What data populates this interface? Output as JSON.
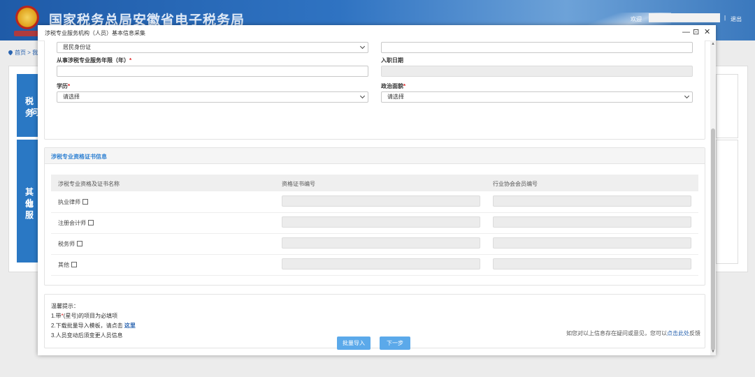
{
  "portal": {
    "site_title": "国家税务总局安徽省电子税务局",
    "welcome": "欢迎",
    "separator": "|",
    "logout": "退出",
    "breadcrumb_home": "首页",
    "breadcrumb_more": "> 我",
    "tile1_text": "税务",
    "tile1_text2": "问",
    "tile2_text": "其他",
    "tile2_text2": "业服"
  },
  "modal": {
    "title": "涉税专业服务机构（人员）基本信息采集",
    "minimize": "—",
    "maximize": "⊡",
    "close": "✕"
  },
  "form": {
    "id_type_value": "居民身份证",
    "years_label": "从事涉税专业服务年限（年）",
    "years_value": "",
    "hire_date_label": "入职日期",
    "hire_date_value": "",
    "education_label": "学历",
    "education_value": "请选择",
    "political_label": "政治面貌",
    "political_value": "请选择",
    "required_mark": "*"
  },
  "cert": {
    "section_title": "涉税专业资格证书信息",
    "col_name": "涉税专业资格及证书名称",
    "col_cert_no": "资格证书编号",
    "col_member_no": "行业协会会员编号",
    "rows": [
      {
        "label": "执业律师",
        "cert_no": "",
        "member_no": ""
      },
      {
        "label": "注册会计师",
        "cert_no": "",
        "member_no": ""
      },
      {
        "label": "税务师",
        "cert_no": "",
        "member_no": ""
      },
      {
        "label": "其他",
        "cert_no": "",
        "member_no": ""
      }
    ]
  },
  "hints": {
    "title": "温馨提示：",
    "line1_prefix": "1.带",
    "line1_mark": "*",
    "line1_suffix": "(星号)的项目为必填项",
    "line2_prefix": "2.下载批量导入模板，请点击 ",
    "line2_link": "这里",
    "line3": "3.人员变动后须变更人员信息"
  },
  "footer": {
    "feedback_prefix": "如您对以上信息存在疑问或意见，您可以",
    "feedback_link": "点击此处",
    "feedback_suffix": "反馈",
    "batch_import": "批量导入",
    "next_step": "下一步"
  },
  "colors": {
    "accent": "#5ba9ea",
    "link": "#2a64b0",
    "section_title": "#2c7fd2",
    "required": "#e02020"
  }
}
